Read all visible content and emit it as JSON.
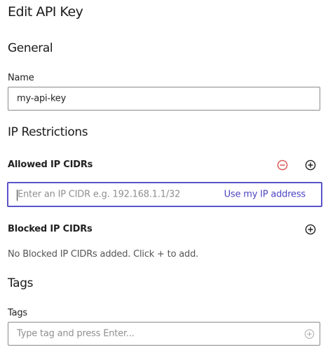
{
  "page": {
    "title": "Edit API Key"
  },
  "general": {
    "heading": "General",
    "name_label": "Name",
    "name_value": "my-api-key"
  },
  "ip_restrictions": {
    "heading": "IP Restrictions",
    "allowed": {
      "label": "Allowed IP CIDRs",
      "placeholder": "Enter an IP CIDR e.g. 192.168.1.1/32",
      "use_my_ip": "Use my IP address"
    },
    "blocked": {
      "label": "Blocked IP CIDRs",
      "empty_text": "No Blocked IP CIDRs added. Click + to add."
    }
  },
  "tags": {
    "heading": "Tags",
    "label": "Tags",
    "placeholder": "Type tag and press Enter..."
  },
  "icons": {
    "remove": "minus-circle-icon",
    "add": "plus-circle-icon"
  },
  "colors": {
    "accent": "#5b54c9",
    "link": "#4c45c2",
    "danger": "#d9534f",
    "border": "#8a8a8a"
  }
}
